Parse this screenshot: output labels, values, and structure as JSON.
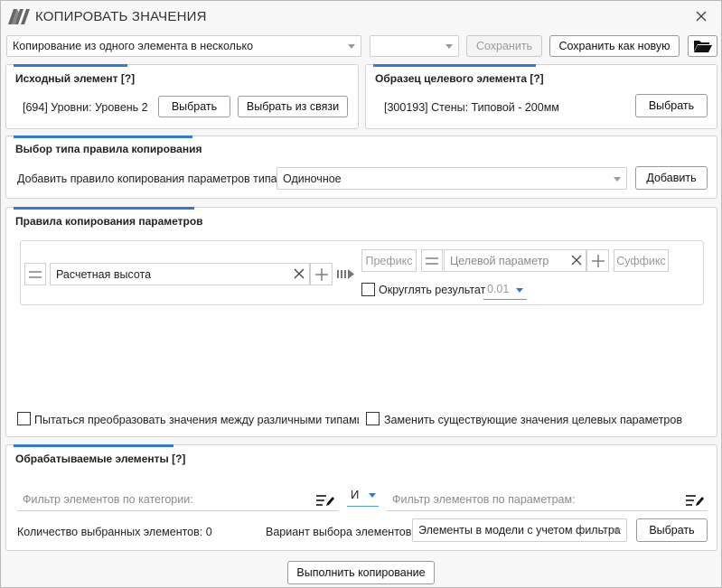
{
  "window": {
    "title": "КОПИРОВАТЬ ЗНАЧЕНИЯ"
  },
  "toolbar": {
    "mode_value": "Копирование из одного элемента в несколько",
    "preset_value": "",
    "save_label": "Сохранить",
    "save_as_new_label": "Сохранить как новую"
  },
  "source": {
    "title": "Исходный элемент [?]",
    "value": "[694] Уровни: Уровень 2",
    "select_label": "Выбрать",
    "select_link_label": "Выбрать из связи"
  },
  "target": {
    "title": "Образец целевого элемента [?]",
    "value": "[300193] Стены: Типовой - 200мм",
    "select_label": "Выбрать"
  },
  "rule_type": {
    "title": "Выбор типа правила копирования",
    "label": "Добавить правило копирования параметров типа:",
    "value": "Одиночное",
    "add_label": "Добавить"
  },
  "rules": {
    "title": "Правила копирования параметров",
    "source_param": "Расчетная высота",
    "prefix_placeholder": "Префикс",
    "target_placeholder": "Целевой параметр",
    "suffix_placeholder": "Суффикс",
    "round_label": "Округлять результат",
    "round_value": "0.01",
    "convert_label": "Пытаться преобразовать значения между различными типами п",
    "replace_label": "Заменить существующие значения целевых параметров"
  },
  "processed": {
    "title": "Обрабатываемые элементы [?]",
    "category_filter_placeholder": "Фильтр элементов по категории:",
    "logic_value": "И",
    "param_filter_placeholder": "Фильтр элементов по параметрам:",
    "count_label": "Количество выбранных элементов: 0",
    "variant_label": "Вариант выбора элементов:",
    "variant_value": "Элементы в модели с учетом фильтра",
    "select_label": "Выбрать"
  },
  "footer": {
    "run_label": "Выполнить копирование"
  },
  "colors": {
    "accent": "#2f7bd3",
    "logo": "#666666"
  }
}
